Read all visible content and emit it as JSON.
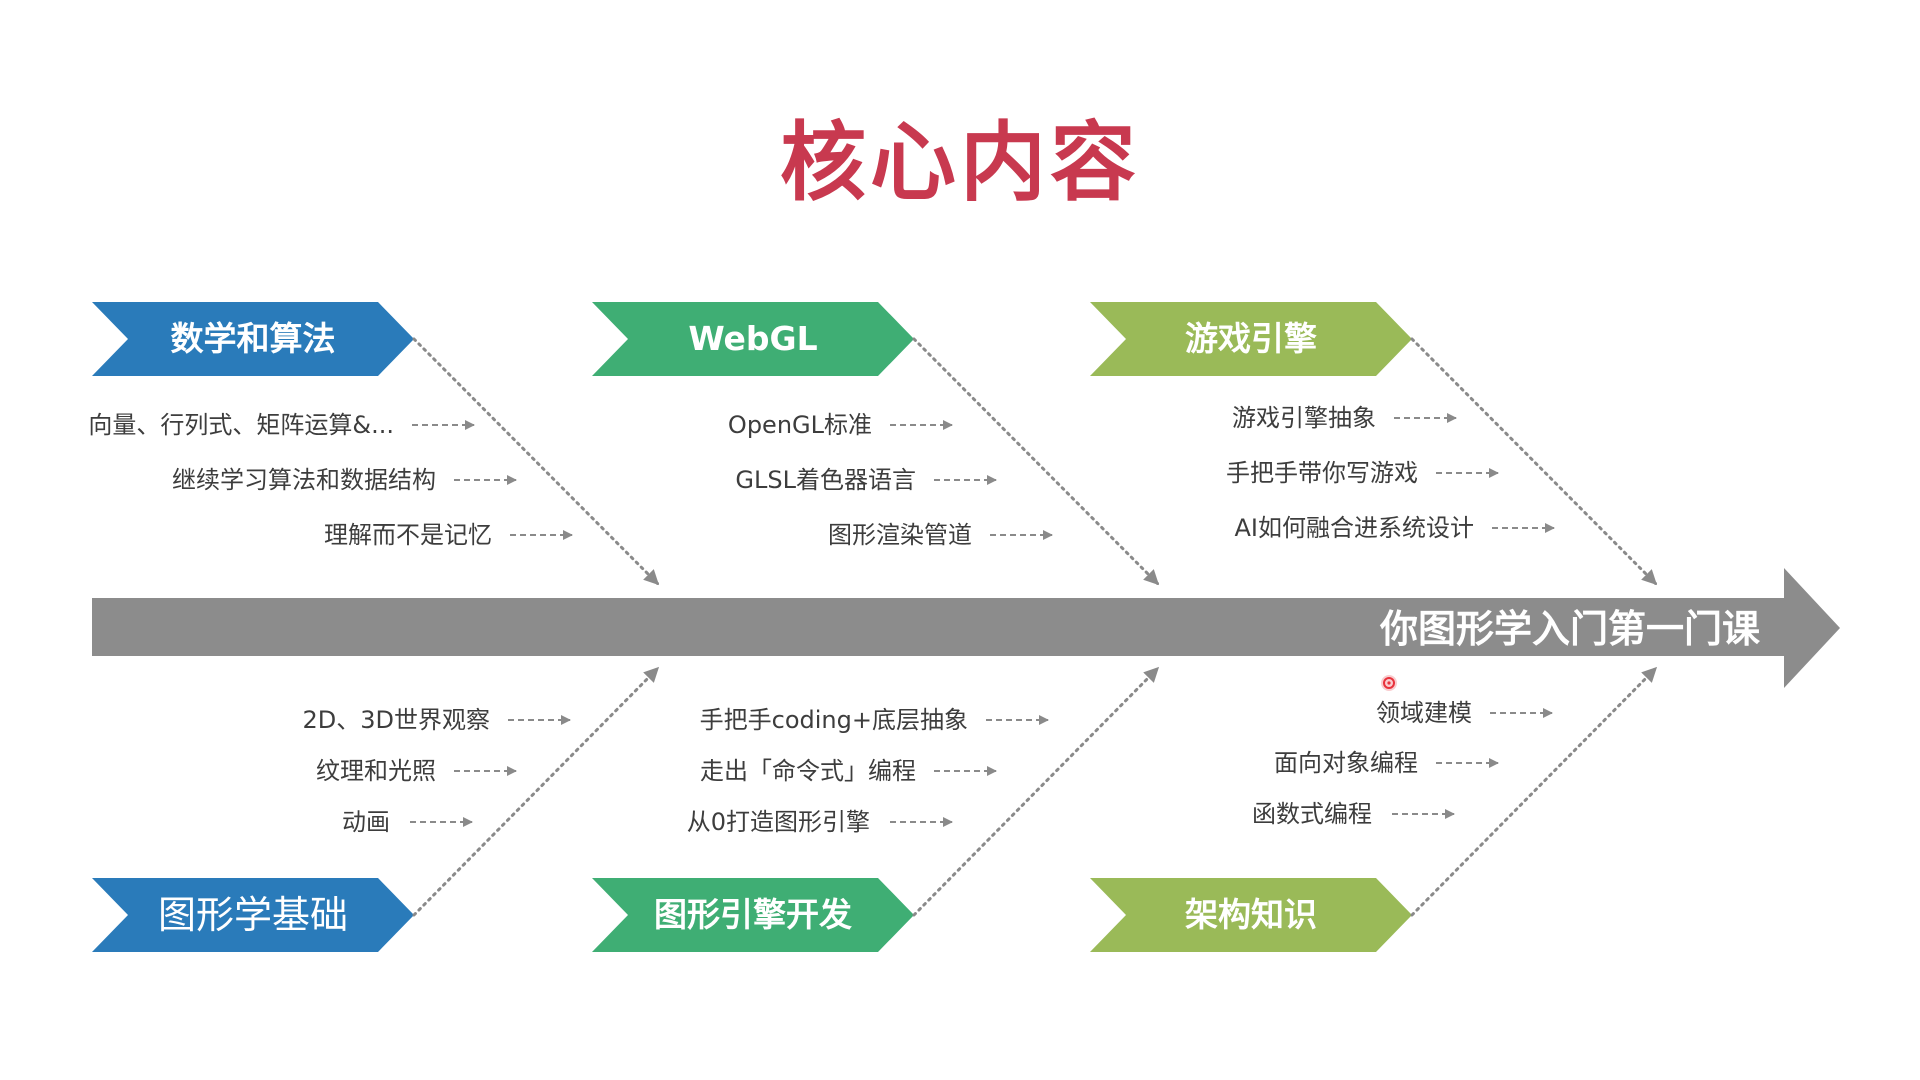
{
  "title": "核心内容",
  "spine": {
    "label": "你图形学入门第一门课"
  },
  "categories": {
    "math": {
      "label": "数学和算法",
      "items": [
        "向量、行列式、矩阵运算&...",
        "继续学习算法和数据结构",
        "理解而不是记忆"
      ]
    },
    "webgl": {
      "label": "WebGL",
      "items": [
        "OpenGL标准",
        "GLSL着色器语言",
        "图形渲染管道"
      ]
    },
    "game": {
      "label": "游戏引擎",
      "items": [
        "游戏引擎抽象",
        "手把手带你写游戏",
        "AI如何融合进系统设计"
      ]
    },
    "basics": {
      "label": "图形学基础",
      "items": [
        "2D、3D世界观察",
        "纹理和光照",
        "动画"
      ]
    },
    "engine": {
      "label": "图形引擎开发",
      "items": [
        "手把手coding+底层抽象",
        "走出「命令式」编程",
        "从0打造图形引擎"
      ]
    },
    "arch": {
      "label": "架构知识",
      "items": [
        "领域建模",
        "面向对象编程",
        "函数式编程"
      ]
    }
  },
  "colors": {
    "title": "#c8394f",
    "blue": "#2a7bba",
    "green": "#3fae74",
    "lime": "#9aba58",
    "spine": "#8c8c8c",
    "connector": "#8a8a8a",
    "text": "#3d3d3d",
    "cursor": "#e8323c"
  }
}
